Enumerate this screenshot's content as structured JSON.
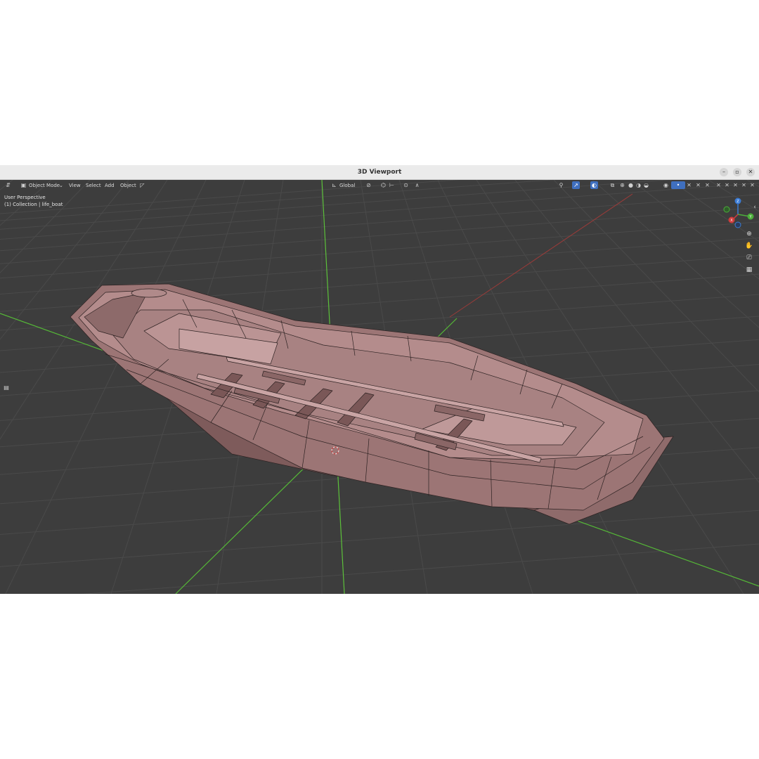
{
  "window": {
    "title": "3D Viewport",
    "controls": [
      "–",
      "▫",
      "✕"
    ]
  },
  "header": {
    "editor_type_icon": "editor-type-icon",
    "mode_label": "Object Mode",
    "menus": [
      "View",
      "Select",
      "Add",
      "Object"
    ],
    "transform_orientation": "Global"
  },
  "overlay": {
    "view_name": "User Perspective",
    "collection_line": "(1) Collection | life_boat"
  },
  "gizmo": {
    "axis_z": "Z",
    "axis_y": "Y",
    "axis_x": "X"
  },
  "colors": {
    "viewport_bg": "#3d3d3d",
    "grid": "#4a4a4a",
    "axis_green": "#5cc13a",
    "axis_red": "#b5413f",
    "mesh_fill": "#9c7575",
    "mesh_wire": "#2a2020",
    "accent": "#3f6fbf"
  },
  "nav_icons": [
    "zoom-icon",
    "pan-hand-icon",
    "camera-view-icon",
    "grid-ortho-icon"
  ]
}
